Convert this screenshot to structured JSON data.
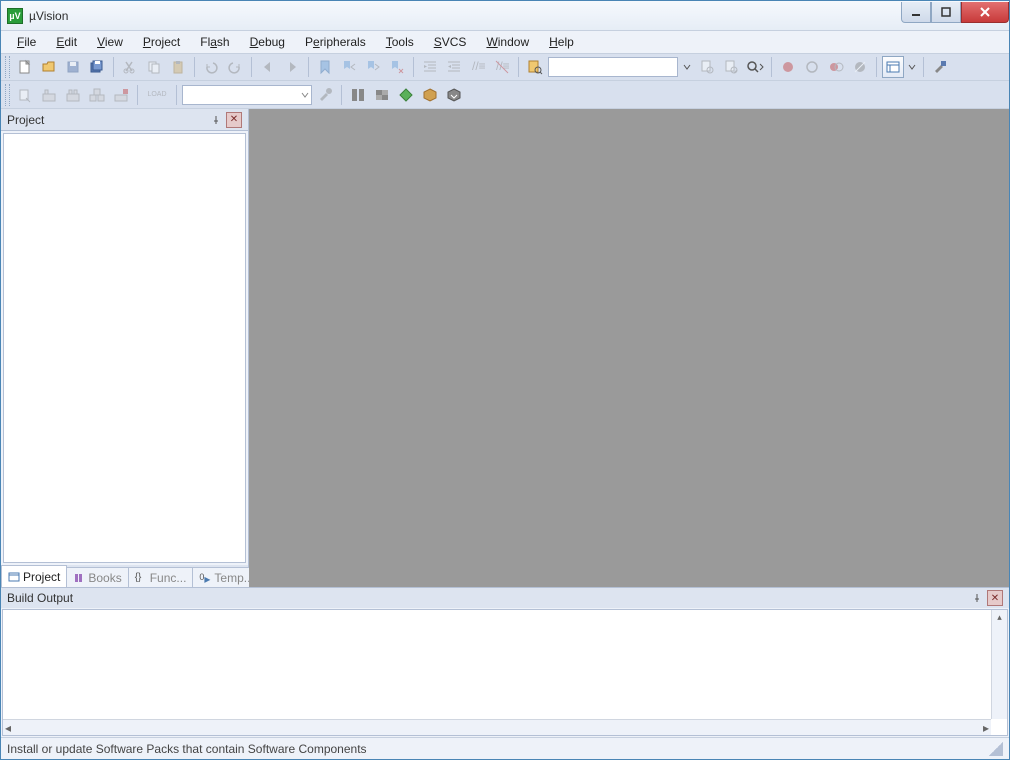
{
  "window": {
    "title": "µVision"
  },
  "menus": {
    "file": "File",
    "edit": "Edit",
    "view": "View",
    "project": "Project",
    "flash": "Flash",
    "debug": "Debug",
    "peripherals": "Peripherals",
    "tools": "Tools",
    "svcs": "SVCS",
    "window": "Window",
    "help": "Help"
  },
  "toolbar1": {
    "find_value": "",
    "icons": {
      "new": "new-file-icon",
      "open": "open-folder-icon",
      "save": "save-icon",
      "saveall": "save-all-icon",
      "cut": "cut-icon",
      "copy": "copy-icon",
      "paste": "paste-icon",
      "undo": "undo-icon",
      "redo": "redo-icon",
      "navback": "nav-back-icon",
      "navfwd": "nav-forward-icon",
      "bookmark": "bookmark-toggle-icon",
      "bookmark_prev": "bookmark-prev-icon",
      "bookmark_next": "bookmark-next-icon",
      "bookmark_clear": "bookmark-clear-icon",
      "indent": "indent-icon",
      "outdent": "outdent-icon",
      "comment": "comment-icon",
      "uncomment": "uncomment-icon",
      "findinfiles": "find-in-files-icon",
      "find_prev": "find-prev-icon",
      "find_next": "find-next-icon",
      "debug_search": "incremental-search-icon",
      "debug_start": "debug-start-icon",
      "breakpoint": "breakpoint-insert-icon",
      "breakpoint_enable": "breakpoint-enable-icon",
      "breakpoint_disable": "breakpoint-disable-icon",
      "breakpoint_kill": "breakpoint-kill-icon",
      "window_list": "window-list-icon",
      "configure": "configure-icon"
    }
  },
  "toolbar2": {
    "target_value": "",
    "load_label": "LOAD",
    "icons": {
      "translate": "translate-icon",
      "build": "build-icon",
      "rebuild": "rebuild-icon",
      "batch_build": "batch-build-icon",
      "stop_build": "stop-build-icon",
      "download": "download-icon",
      "target_options": "target-options-icon",
      "file_ext": "file-extensions-icon",
      "manage_rte": "manage-rte-icon",
      "select_packs": "select-packs-icon",
      "pack_installer": "pack-installer-icon",
      "manage_multi": "manage-multi-project-icon"
    }
  },
  "project_panel": {
    "title": "Project",
    "tabs": {
      "project": "Project",
      "books": "Books",
      "functions": "Func...",
      "templates": "Temp..."
    }
  },
  "build_output": {
    "title": "Build Output"
  },
  "statusbar": {
    "message": "Install or update Software Packs that contain Software Components"
  }
}
